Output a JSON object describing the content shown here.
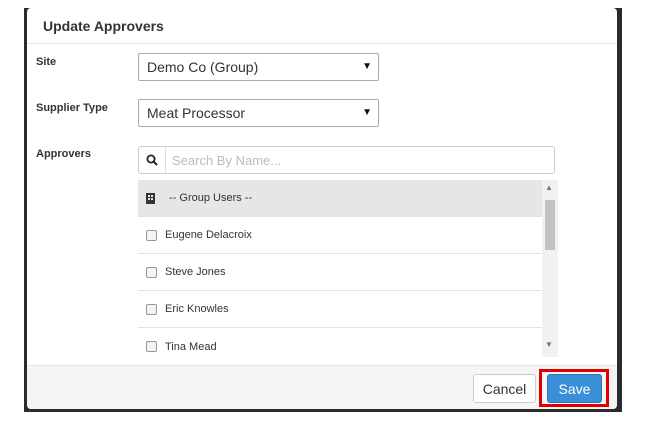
{
  "modal": {
    "title": "Update Approvers"
  },
  "site": {
    "label": "Site",
    "value": "Demo Co (Group)"
  },
  "supplier_type": {
    "label": "Supplier Type",
    "value": "Meat Processor"
  },
  "approvers": {
    "label": "Approvers",
    "search_placeholder": "Search By Name...",
    "group_label": "-- Group Users --",
    "users": [
      {
        "name": "Eugene Delacroix",
        "checked": false
      },
      {
        "name": "Steve Jones",
        "checked": false
      },
      {
        "name": "Eric Knowles",
        "checked": false
      },
      {
        "name": "Tina Mead",
        "checked": false
      }
    ]
  },
  "footer": {
    "cancel_label": "Cancel",
    "save_label": "Save",
    "highlight_color": "#e00000"
  },
  "icons": {
    "caret": "▼",
    "scroll_up": "▲",
    "scroll_down": "▼"
  }
}
